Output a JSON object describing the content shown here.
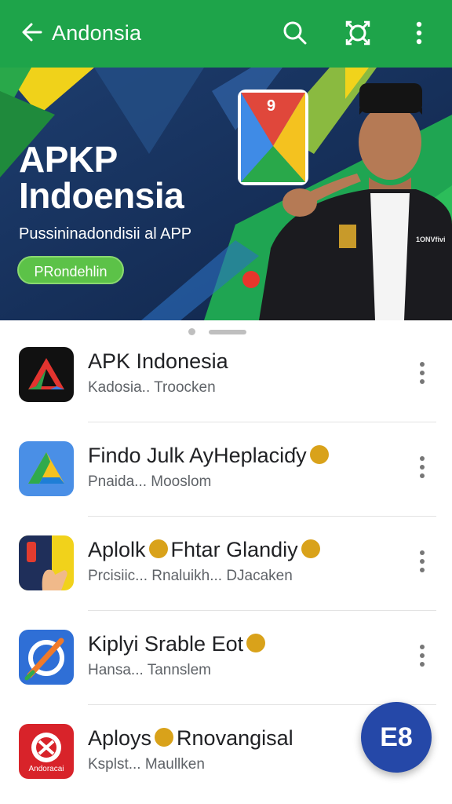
{
  "appbar": {
    "title": "Andonsia",
    "icons": [
      "back-arrow-icon",
      "search-icon",
      "cast-icon",
      "more-vertical-icon"
    ],
    "color": "#1ea44a"
  },
  "banner": {
    "headline_line1": "APKP",
    "headline_line2": "Indoensia",
    "subline": "Pussininadondisii al APP",
    "cta_label": "PRondehlin",
    "app_tile_number": "9",
    "jacket_patch_text": "1ONVfivi"
  },
  "list": {
    "items": [
      {
        "name": "APK Indonesia",
        "sub": "Kadosia.. Troocken",
        "verified": false,
        "icon": "red-triangle-app-icon"
      },
      {
        "name": "Findo Julk AyHeplaciɗy",
        "sub": "Pnaida... Mooslom",
        "verified": true,
        "icon": "green-triangle-app-icon"
      },
      {
        "name_a": "Aplolk",
        "name_b": "Fhtar Glandiy",
        "sub": "Prcisiic... Rnaluikh... DJacaken",
        "verified": true,
        "icon": "hand-book-app-icon"
      },
      {
        "name": "Kiplyi Srable Eot",
        "sub": "Hansa... Tannslem",
        "verified": true,
        "icon": "pen-edit-app-icon"
      },
      {
        "name_a": "Aploys",
        "name_b": "Rnovangisal",
        "sub": "Ksplst... Maullken",
        "verified": false,
        "icon": "red-spider-app-icon",
        "icon_label": "Andoracai"
      }
    ]
  },
  "fab": {
    "label": "E8",
    "color": "#2548a8"
  },
  "accent_colors": {
    "green": "#1ea44a",
    "badge": "#d9a21a",
    "fab": "#2548a8"
  }
}
